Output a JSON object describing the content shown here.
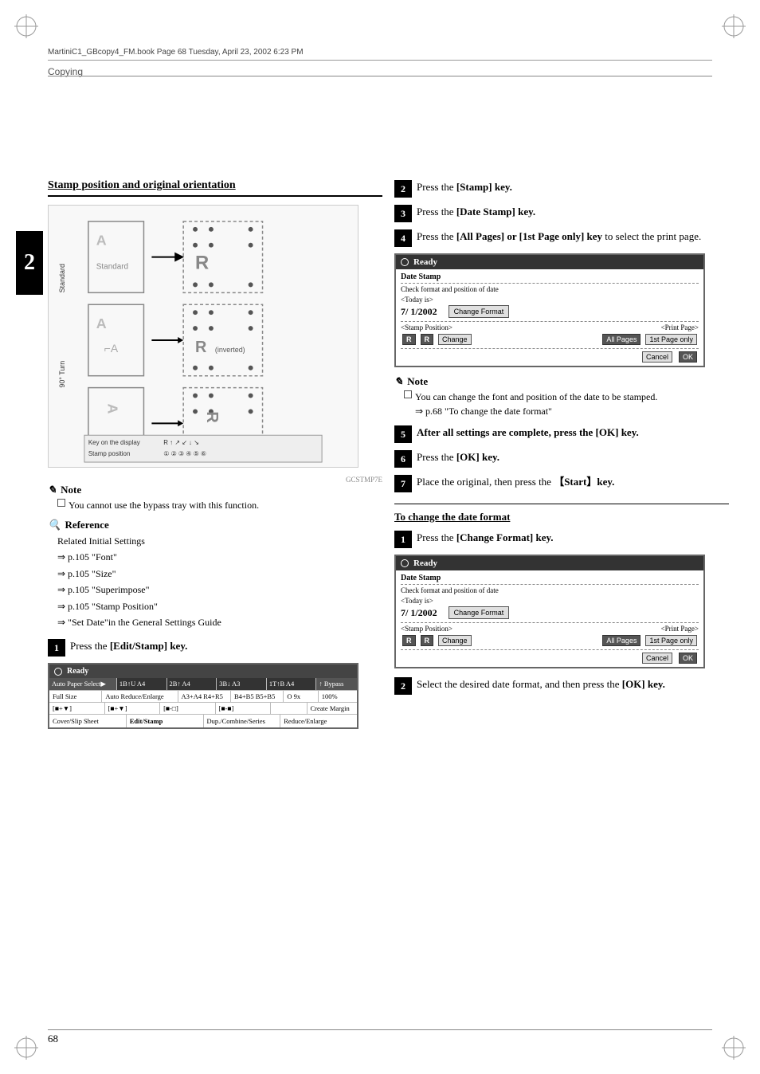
{
  "page": {
    "number": "68",
    "section": "Copying",
    "header_file": "MartiniC1_GBcopy4_FM.book  Page 68  Tuesday, April 23, 2002  6:23 PM"
  },
  "left_column": {
    "heading": "Stamp position and original orientation",
    "note_title": "Note",
    "note_text": "You cannot use the bypass tray with this function.",
    "ref_title": "Reference",
    "ref_items": [
      "Related Initial Settings",
      "⇒ p.105 \"Font\"",
      "⇒ p.105 \"Size\"",
      "⇒ p.105 \"Superimpose\"",
      "⇒ p.105 \"Stamp Position\"",
      "⇒ \"Set Date\"in the General Settings Guide"
    ],
    "step1": {
      "num": "1",
      "text": "Press the [Edit/Stamp] key."
    },
    "diagram_caption": "GCSTMP7E"
  },
  "right_column": {
    "step2": {
      "num": "2",
      "text": "Press the [Stamp] key."
    },
    "step3": {
      "num": "3",
      "text": "Press the [Date Stamp] key."
    },
    "step4": {
      "num": "4",
      "text": "Press the [All Pages] or [1st Page only] key to select the print page."
    },
    "screen1": {
      "title": "Ready",
      "stamp_label": "Date Stamp",
      "check_label": "Check format and position of date",
      "today_label": "<Today is>",
      "date_value": "7/ 1/2002",
      "change_format_btn": "Change Format",
      "stamp_position_label": "<Stamp Position>",
      "print_page_label": "<Print Page>",
      "r_btn1": "R",
      "r_btn2": "R",
      "change_btn": "Change",
      "all_pages_btn": "All Pages",
      "first_page_btn": "1st Page only",
      "cancel_btn": "Cancel",
      "ok_btn": "OK"
    },
    "note2_title": "Note",
    "note2_text1": "You can change the font and position of the date to be stamped.",
    "note2_text2": "⇒ p.68 \"To change the date format\"",
    "step5": {
      "num": "5",
      "text": "After all settings are complete, press the [OK] key."
    },
    "step6": {
      "num": "6",
      "text": "Press the [OK] key."
    },
    "step7": {
      "num": "7",
      "text": "Place the original, then press the [Start] key."
    },
    "sub_section": "To change the date format",
    "step_a1": {
      "num": "1",
      "text": "Press the [Change Format] key."
    },
    "screen2": {
      "title": "Ready",
      "stamp_label": "Date Stamp",
      "check_label": "Check format and position of date",
      "today_label": "<Today is>",
      "date_value": "7/ 1/2002",
      "change_format_btn": "Change Format",
      "stamp_position_label": "<Stamp Position>",
      "print_page_label": "<Print Page>",
      "r_btn1": "R",
      "r_btn2": "R",
      "change_btn": "Change",
      "all_pages_btn": "All Pages",
      "first_page_btn": "1st Page only",
      "cancel_btn": "Cancel",
      "ok_btn": "OK"
    },
    "step_a2": {
      "num": "2",
      "text": "Select the desired date format, and then press the [OK] key."
    }
  },
  "big_screen": {
    "title": "Ready",
    "rows": [
      [
        "Auto Paper Select▶",
        "1B↑U  A4",
        "2B↑  A4",
        "3B↓  A3",
        "1T↑B  A4",
        "↑  Bypass"
      ],
      [
        "Full Size",
        "Auto Reduce/Enlarge",
        "A3+A4 R4+R5",
        "B4+B5 B5+B5",
        "O 9x",
        "100%"
      ],
      [
        "[■+▼]",
        "[■+▼]",
        "[■-□]",
        "[■-■]",
        "",
        "Create Margin"
      ],
      [
        "Cover/Slip Sheet",
        "Edit/Stamp",
        "Dup/Combine/Series",
        "Reduce/Enlarge"
      ]
    ]
  }
}
